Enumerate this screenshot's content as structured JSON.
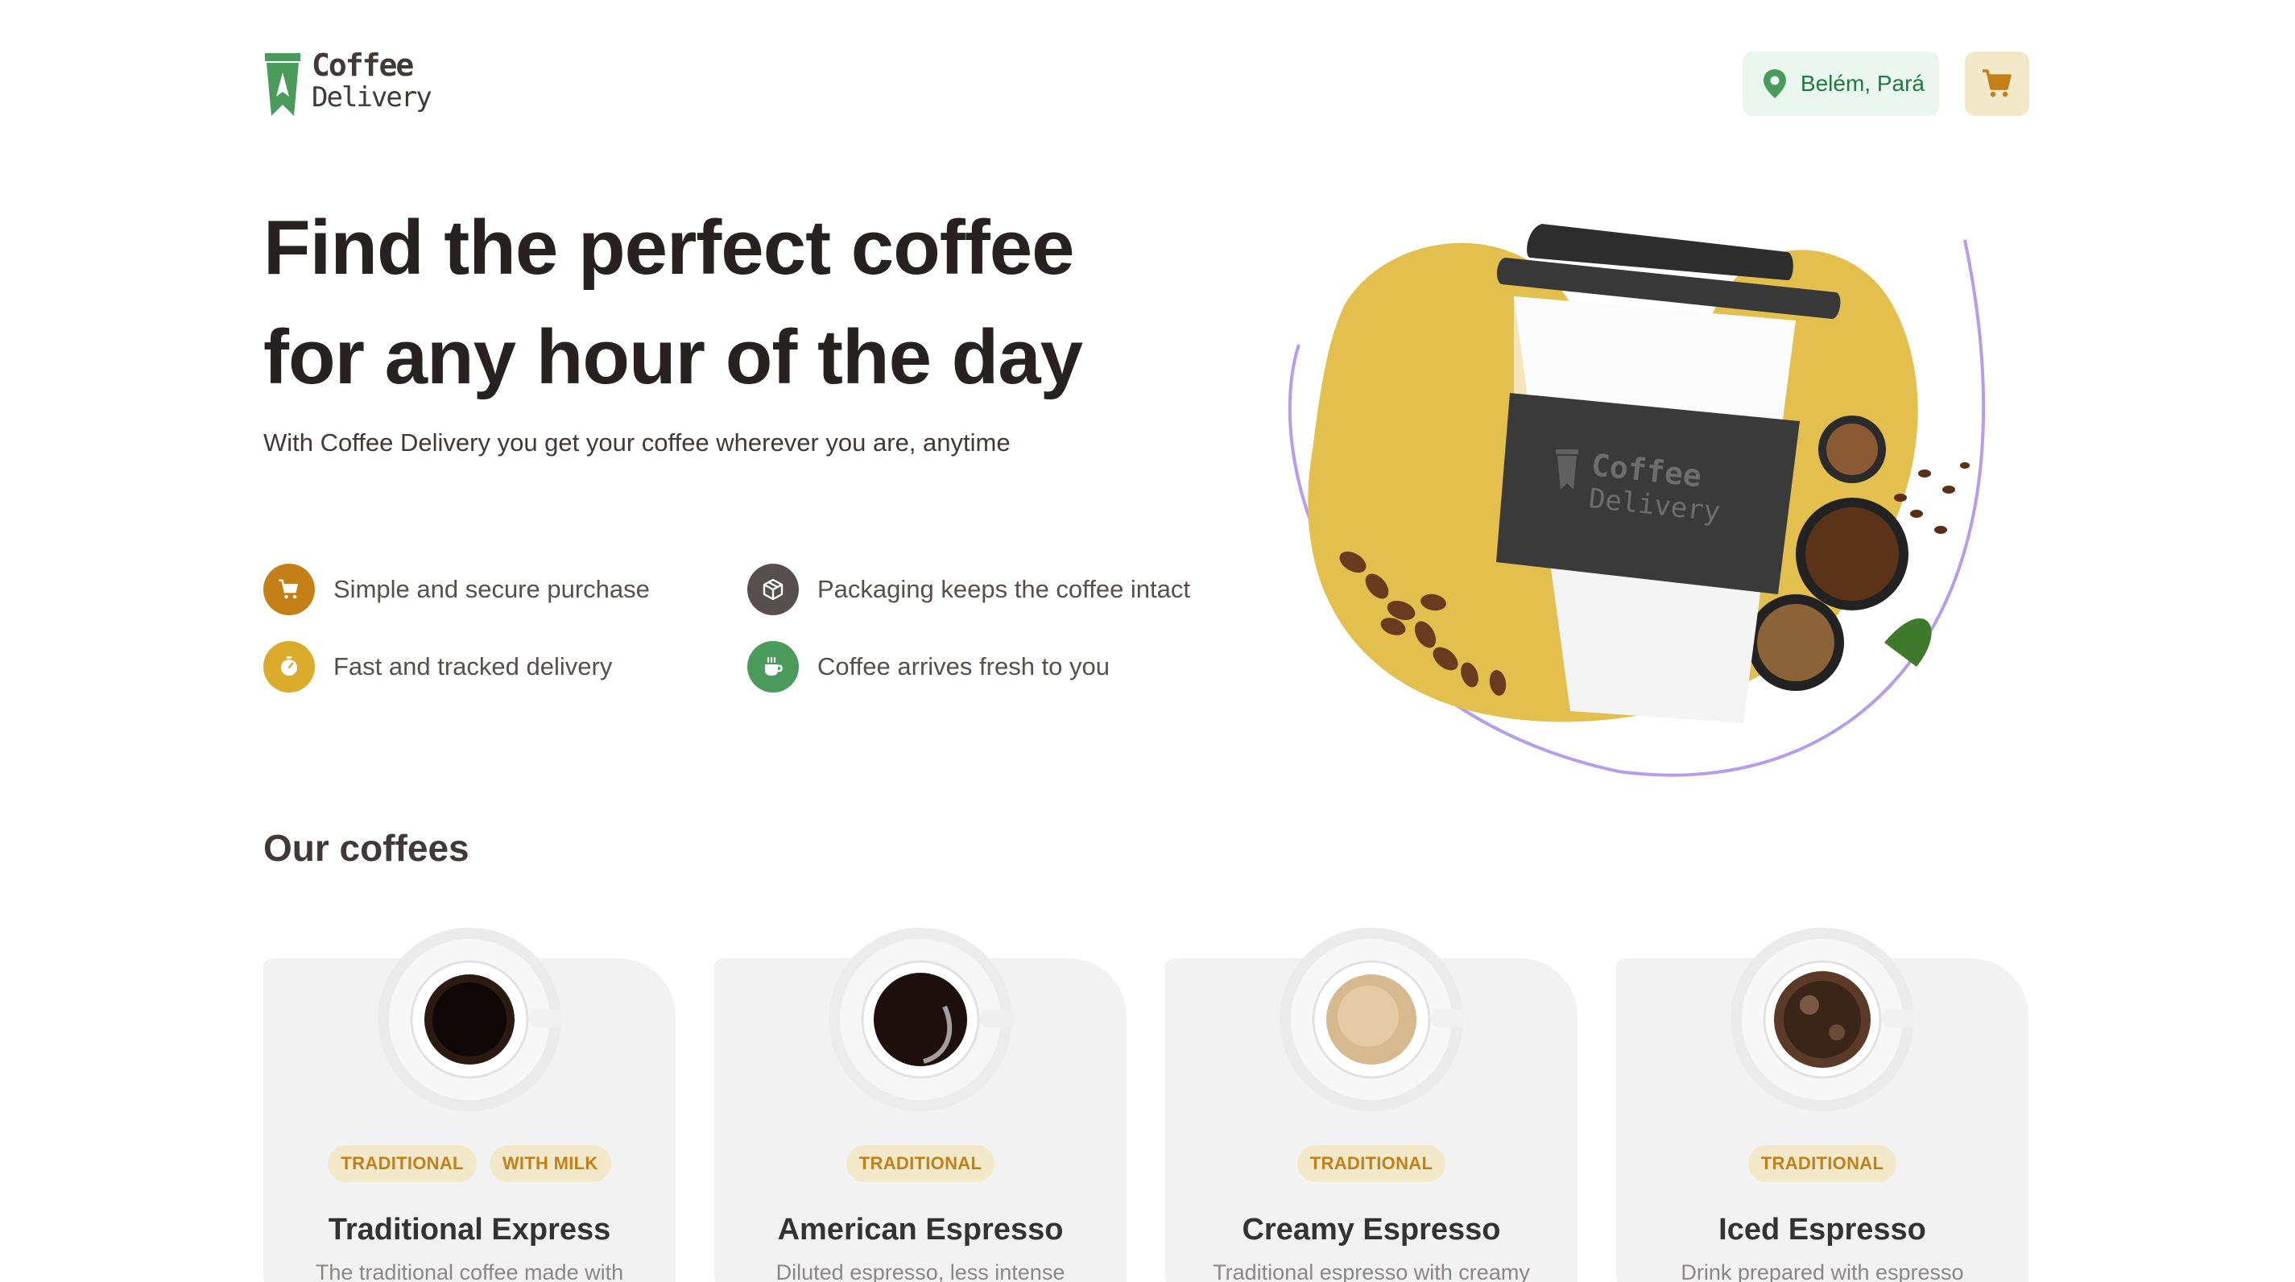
{
  "header": {
    "logo_line1": "Coffee",
    "logo_line2": "Delivery",
    "location": "Belém, Pará",
    "colors": {
      "location_bg": "#EBF7EE",
      "location_text": "#1E7B3C",
      "cart_bg": "#F1E9C9",
      "cart_icon": "#C47F17"
    }
  },
  "hero": {
    "title_line1": "Find the perfect coffee",
    "title_line2": "for any hour of the day",
    "subtitle": "With Coffee Delivery you get your coffee wherever you are, anytime",
    "cup_logo_line1": "Coffee",
    "cup_logo_line2": "Delivery",
    "features": [
      {
        "label": "Simple and secure purchase",
        "icon": "cart-icon",
        "color": "#C47F17"
      },
      {
        "label": "Packaging keeps the coffee intact",
        "icon": "package-icon",
        "color": "#574F4D"
      },
      {
        "label": "Fast and tracked delivery",
        "icon": "timer-icon",
        "color": "#DBAC2C"
      },
      {
        "label": "Coffee arrives fresh to you",
        "icon": "coffee-icon",
        "color": "#4B9C5C"
      }
    ]
  },
  "section": {
    "title": "Our coffees"
  },
  "coffees": [
    {
      "tags": [
        "TRADITIONAL",
        "WITH MILK"
      ],
      "name": "Traditional Express",
      "description": "The traditional coffee made with",
      "crema": "#2a1a12"
    },
    {
      "tags": [
        "TRADITIONAL"
      ],
      "name": "American Espresso",
      "description": "Diluted espresso, less intense",
      "crema": "#1d0f0b"
    },
    {
      "tags": [
        "TRADITIONAL"
      ],
      "name": "Creamy Espresso",
      "description": "Traditional espresso with creamy",
      "crema": "#d7b98f"
    },
    {
      "tags": [
        "TRADITIONAL"
      ],
      "name": "Iced Espresso",
      "description": "Drink prepared with espresso",
      "crema": "#5b3b28"
    }
  ]
}
